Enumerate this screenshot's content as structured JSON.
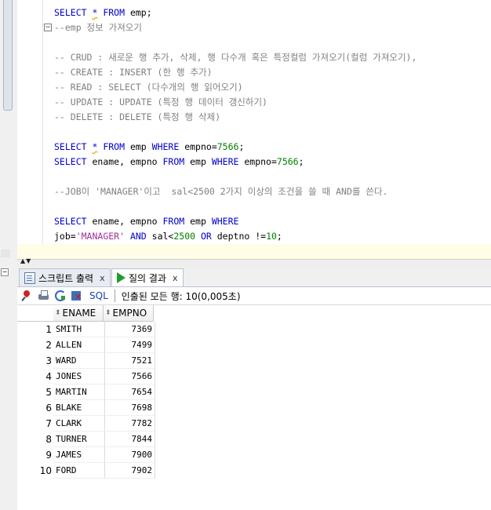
{
  "editor": {
    "lines": [
      {
        "parts": [
          {
            "t": "SELECT ",
            "c": "kw"
          },
          {
            "t": "*",
            "c": "kw squiggle"
          },
          {
            "t": " FROM ",
            "c": "kw"
          },
          {
            "t": "emp;",
            "c": "plain"
          }
        ]
      },
      {
        "parts": [
          {
            "t": "--emp 정보 가져오기",
            "c": "cm"
          }
        ]
      },
      {
        "parts": []
      },
      {
        "parts": [
          {
            "t": "-- CRUD : 새로운 행 추가, 삭제, 행 다수개 혹은 특정컬럼 가져오기(컬럼 가져오기),",
            "c": "cm"
          }
        ]
      },
      {
        "parts": [
          {
            "t": "-- CREATE : INSERT (한 행 추가)",
            "c": "cm"
          }
        ]
      },
      {
        "parts": [
          {
            "t": "-- READ : SELECT (다수개의 행 읽어오기)",
            "c": "cm"
          }
        ]
      },
      {
        "parts": [
          {
            "t": "-- UPDATE : UPDATE (특정 행 데이터 갱신하기)",
            "c": "cm"
          }
        ]
      },
      {
        "parts": [
          {
            "t": "-- DELETE : DELETE (특정 행 삭제)",
            "c": "cm"
          }
        ]
      },
      {
        "parts": []
      },
      {
        "parts": [
          {
            "t": "SELECT ",
            "c": "kw"
          },
          {
            "t": "*",
            "c": "kw squiggle"
          },
          {
            "t": " FROM ",
            "c": "kw"
          },
          {
            "t": "emp ",
            "c": "plain"
          },
          {
            "t": "WHERE ",
            "c": "kw"
          },
          {
            "t": "empno=",
            "c": "plain"
          },
          {
            "t": "7566",
            "c": "num"
          },
          {
            "t": ";",
            "c": "plain"
          }
        ]
      },
      {
        "parts": [
          {
            "t": "SELECT ",
            "c": "kw"
          },
          {
            "t": "ename, empno ",
            "c": "plain"
          },
          {
            "t": "FROM ",
            "c": "kw"
          },
          {
            "t": "emp ",
            "c": "plain"
          },
          {
            "t": "WHERE ",
            "c": "kw"
          },
          {
            "t": "empno=",
            "c": "plain"
          },
          {
            "t": "7566",
            "c": "num"
          },
          {
            "t": ";",
            "c": "plain"
          }
        ]
      },
      {
        "parts": []
      },
      {
        "parts": [
          {
            "t": "--JOB이 'MANAGER'이고  sal<2500 2가지 이상의 조건을 쓸 때 AND를 쓴다.",
            "c": "cm"
          }
        ]
      },
      {
        "parts": []
      },
      {
        "parts": [
          {
            "t": "SELECT ",
            "c": "kw"
          },
          {
            "t": "ename, empno ",
            "c": "plain"
          },
          {
            "t": "FROM ",
            "c": "kw"
          },
          {
            "t": "emp ",
            "c": "plain"
          },
          {
            "t": "WHERE",
            "c": "kw"
          }
        ]
      },
      {
        "parts": [
          {
            "t": "job=",
            "c": "plain"
          },
          {
            "t": "'MANAGER'",
            "c": "str"
          },
          {
            "t": " AND ",
            "c": "kw"
          },
          {
            "t": "sal<",
            "c": "plain"
          },
          {
            "t": "2500",
            "c": "num"
          },
          {
            "t": " OR ",
            "c": "kw"
          },
          {
            "t": "deptno !=",
            "c": "plain"
          },
          {
            "t": "10",
            "c": "num"
          },
          {
            "t": ";",
            "c": "plain"
          }
        ]
      }
    ]
  },
  "tabs": {
    "script_output": "스크립트 출력",
    "query_result": "질의 결과",
    "close": "x"
  },
  "toolbar": {
    "sql_label": "SQL",
    "status": "인출된 모든 행: 10(0,005초)"
  },
  "grid": {
    "columns": [
      "ENAME",
      "EMPNO"
    ],
    "rows": [
      {
        "n": "1",
        "ename": "SMITH",
        "empno": "7369"
      },
      {
        "n": "2",
        "ename": "ALLEN",
        "empno": "7499"
      },
      {
        "n": "3",
        "ename": "WARD",
        "empno": "7521"
      },
      {
        "n": "4",
        "ename": "JONES",
        "empno": "7566"
      },
      {
        "n": "5",
        "ename": "MARTIN",
        "empno": "7654"
      },
      {
        "n": "6",
        "ename": "BLAKE",
        "empno": "7698"
      },
      {
        "n": "7",
        "ename": "CLARK",
        "empno": "7782"
      },
      {
        "n": "8",
        "ename": "TURNER",
        "empno": "7844"
      },
      {
        "n": "9",
        "ename": "JAMES",
        "empno": "7900"
      },
      {
        "n": "10",
        "ename": "FORD",
        "empno": "7902"
      }
    ]
  }
}
